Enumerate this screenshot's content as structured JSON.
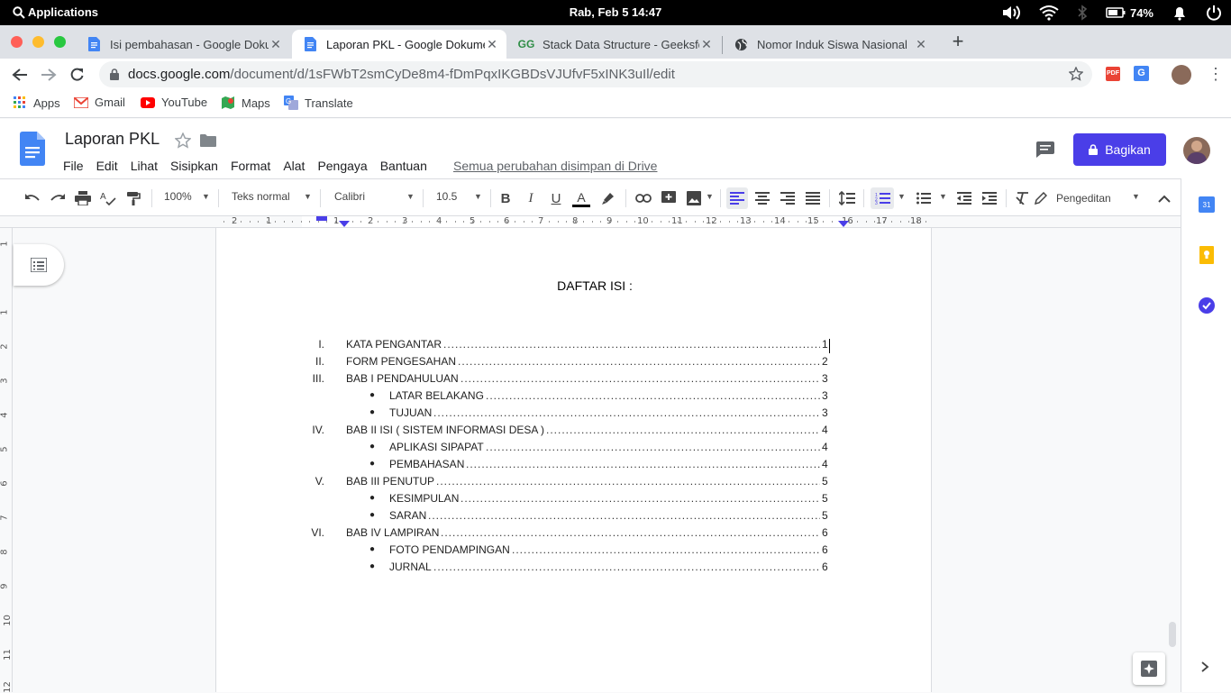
{
  "system": {
    "apps_label": "Applications",
    "clock": "Rab, Feb  5    14:47",
    "battery": "74%"
  },
  "tabs": [
    {
      "title": "Isi pembahasan - Google Dokumen",
      "active": false
    },
    {
      "title": "Laporan PKL - Google Dokumen",
      "active": true
    },
    {
      "title": "Stack Data Structure - GeeksforGeeks",
      "active": false
    },
    {
      "title": "Nomor Induk Siswa Nasional",
      "active": false
    }
  ],
  "address": {
    "host": "docs.google.com",
    "path": "/document/d/1sFWbT2smCyDe8m4-fDmPqxIKGBDsVJUfvF5xINK3uIl/edit"
  },
  "bookmarks": [
    "Apps",
    "Gmail",
    "YouTube",
    "Maps",
    "Translate"
  ],
  "doc": {
    "title": "Laporan PKL",
    "menu": [
      "File",
      "Edit",
      "Lihat",
      "Sisipkan",
      "Format",
      "Alat",
      "Pengaya",
      "Bantuan"
    ],
    "saved_status": "Semua perubahan disimpan di Drive",
    "share_label": "Bagikan"
  },
  "toolbar": {
    "zoom": "100%",
    "style": "Teks normal",
    "font": "Calibri",
    "size": "10.5",
    "mode": "Pengeditan"
  },
  "ruler": {
    "numbers": [
      "2",
      "1",
      "1",
      "2",
      "3",
      "4",
      "5",
      "6",
      "7",
      "8",
      "9",
      "10",
      "11",
      "12",
      "13",
      "14",
      "15",
      "16",
      "17",
      "18"
    ]
  },
  "vruler": {
    "numbers": [
      "1",
      "1",
      "2",
      "3",
      "4",
      "5",
      "6",
      "7",
      "8",
      "9",
      "10",
      "11",
      "12"
    ]
  },
  "toc": {
    "heading": "DAFTAR ISI :",
    "entries": [
      {
        "num": "I.",
        "label": "KATA PENGANTAR",
        "page": "1",
        "level": 0
      },
      {
        "num": "II.",
        "label": "FORM PENGESAHAN",
        "page": "2",
        "level": 0
      },
      {
        "num": "III.",
        "label": "BAB I  PENDAHULUAN",
        "page": "3",
        "level": 0
      },
      {
        "num": "●",
        "label": "LATAR BELAKANG",
        "page": "3",
        "level": 1
      },
      {
        "num": "●",
        "label": "TUJUAN",
        "page": "3",
        "level": 1
      },
      {
        "num": "IV.",
        "label": "BAB II ISI ( SISTEM INFORMASI DESA )",
        "page": "4",
        "level": 0
      },
      {
        "num": "●",
        "label": "APLIKASI SIPAPAT",
        "page": "4",
        "level": 1
      },
      {
        "num": "●",
        "label": "PEMBAHASAN",
        "page": "4",
        "level": 1
      },
      {
        "num": "V.",
        "label": "BAB III PENUTUP",
        "page": "5",
        "level": 0
      },
      {
        "num": "●",
        "label": "KESIMPULAN",
        "page": "5",
        "level": 1
      },
      {
        "num": "●",
        "label": "SARAN",
        "page": "5",
        "level": 1
      },
      {
        "num": "VI.",
        "label": "BAB IV  LAMPIRAN",
        "page": "6",
        "level": 0
      },
      {
        "num": "●",
        "label": "FOTO PENDAMPINGAN",
        "page": "6",
        "level": 1
      },
      {
        "num": "●",
        "label": "JURNAL",
        "page": "6",
        "level": 1
      }
    ]
  },
  "colors": {
    "docs_blue": "#4285f4",
    "share_purple": "#4a3ee8",
    "calendar_blue": "#4285f4",
    "keep_yellow": "#fbbc04",
    "tasks_blue": "#4a3ee8"
  }
}
